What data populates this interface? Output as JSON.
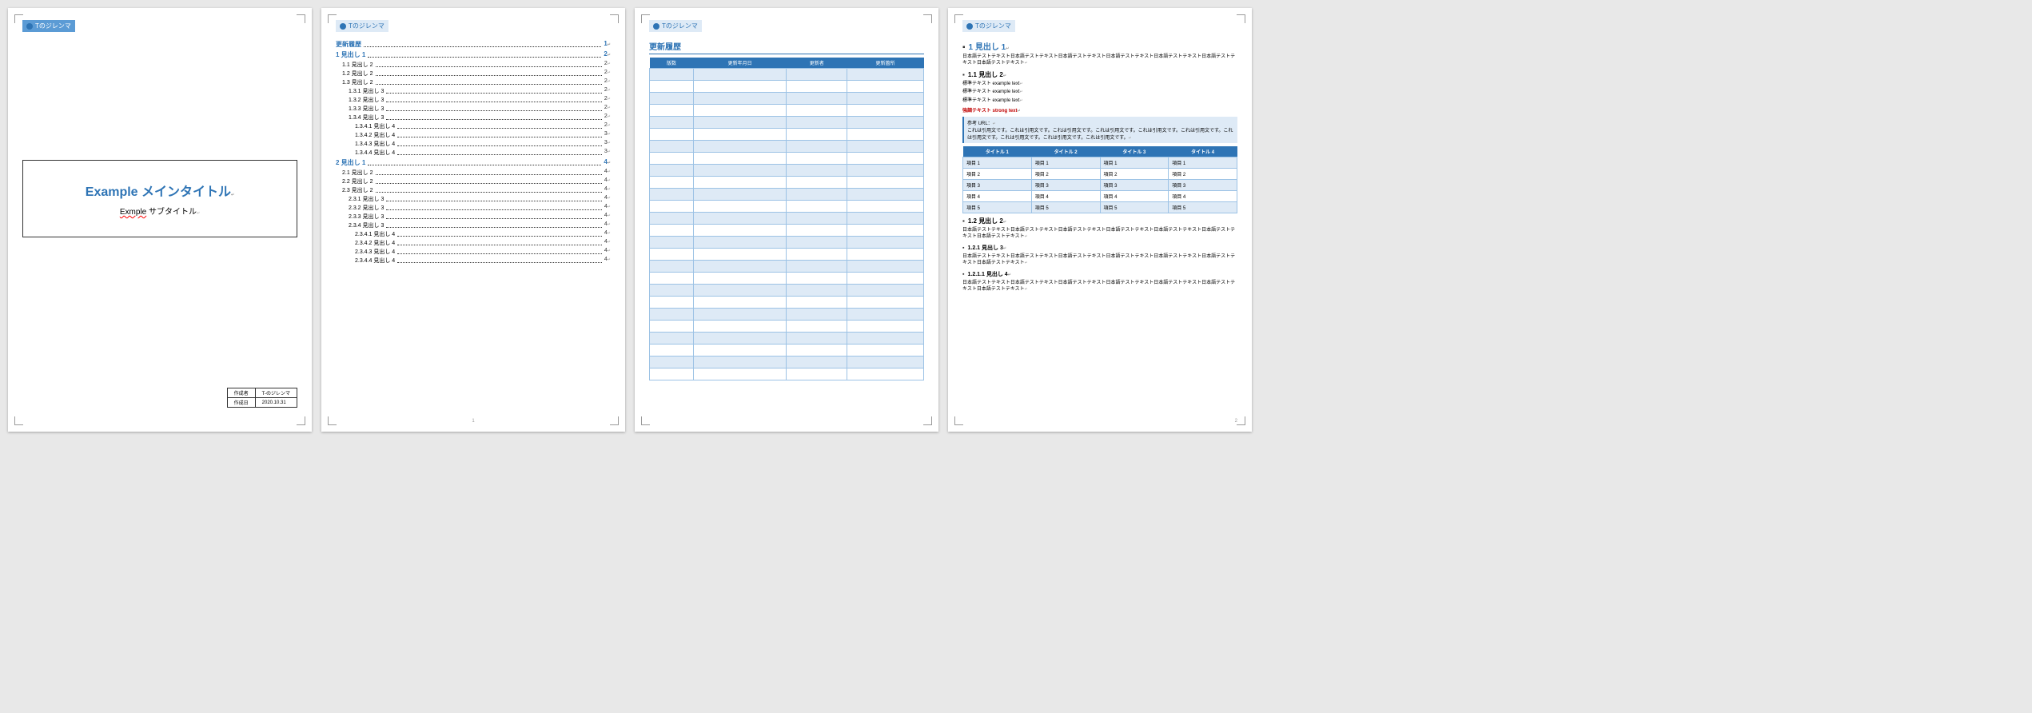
{
  "header": {
    "brand": "Tのジレンマ"
  },
  "page1": {
    "main_title": "Example メインタイトル",
    "sub_title_prefix": "Exmple",
    "sub_title_rest": " サブタイトル",
    "meta": {
      "author_label": "作成者",
      "author": "T-のジレンマ",
      "date_label": "作成日",
      "date": "2020.10.31"
    }
  },
  "toc": {
    "items": [
      {
        "lvl": 1,
        "label": "更新履歴",
        "page": "1"
      },
      {
        "lvl": 1,
        "label": "1 見出し 1",
        "page": "2"
      },
      {
        "lvl": 2,
        "label": "1.1 見出し 2",
        "page": "2"
      },
      {
        "lvl": 2,
        "label": "1.2 見出し 2",
        "page": "2"
      },
      {
        "lvl": 2,
        "label": "1.3 見出し 2",
        "page": "2"
      },
      {
        "lvl": 3,
        "label": "1.3.1 見出し 3",
        "page": "2"
      },
      {
        "lvl": 3,
        "label": "1.3.2 見出し 3",
        "page": "2"
      },
      {
        "lvl": 3,
        "label": "1.3.3 見出し 3",
        "page": "2"
      },
      {
        "lvl": 3,
        "label": "1.3.4 見出し 3",
        "page": "2"
      },
      {
        "lvl": 4,
        "label": "1.3.4.1 見出し 4",
        "page": "2"
      },
      {
        "lvl": 4,
        "label": "1.3.4.2 見出し 4",
        "page": "3"
      },
      {
        "lvl": 4,
        "label": "1.3.4.3 見出し 4",
        "page": "3"
      },
      {
        "lvl": 4,
        "label": "1.3.4.4 見出し 4",
        "page": "3"
      },
      {
        "lvl": 1,
        "label": "2 見出し 1",
        "page": "4"
      },
      {
        "lvl": 2,
        "label": "2.1 見出し 2",
        "page": "4"
      },
      {
        "lvl": 2,
        "label": "2.2 見出し 2",
        "page": "4"
      },
      {
        "lvl": 2,
        "label": "2.3 見出し 2",
        "page": "4"
      },
      {
        "lvl": 3,
        "label": "2.3.1 見出し 3",
        "page": "4"
      },
      {
        "lvl": 3,
        "label": "2.3.2 見出し 3",
        "page": "4"
      },
      {
        "lvl": 3,
        "label": "2.3.3 見出し 3",
        "page": "4"
      },
      {
        "lvl": 3,
        "label": "2.3.4 見出し 3",
        "page": "4"
      },
      {
        "lvl": 4,
        "label": "2.3.4.1 見出し 4",
        "page": "4"
      },
      {
        "lvl": 4,
        "label": "2.3.4.2 見出し 4",
        "page": "4"
      },
      {
        "lvl": 4,
        "label": "2.3.4.3 見出し 4",
        "page": "4"
      },
      {
        "lvl": 4,
        "label": "2.3.4.4 見出し 4",
        "page": "4"
      }
    ]
  },
  "history": {
    "title": "更新履歴",
    "cols": [
      "版数",
      "更新年月日",
      "更新者",
      "更新箇所"
    ],
    "rows": 26
  },
  "page4": {
    "h1": "1 見出し 1",
    "body1": "日本語テストテキスト日本語テストテキスト日本語テストテキスト日本語テストテキスト日本語テストテキスト日本語テストテキスト日本語テストテキスト",
    "h2a": "1.1 見出し 2",
    "std_lines": [
      "標準テキスト example text",
      "標準テキスト example text",
      "標準テキスト example text"
    ],
    "strong": "強調テキスト strong text",
    "quote_label": "参考 URL：",
    "quote_body": "これは引用文です。これは引用文です。これは引用文です。これは引用文です。これは引用文です。これは引用文です。これは引用文です。これは引用文です。これは引用文です。これは引用文です。",
    "table_headers": [
      "タイトル 1",
      "タイトル 2",
      "タイトル 3",
      "タイトル 4"
    ],
    "table_rows": [
      [
        "項目 1",
        "項目 1",
        "項目 1",
        "項目 1"
      ],
      [
        "項目 2",
        "項目 2",
        "項目 2",
        "項目 2"
      ],
      [
        "項目 3",
        "項目 3",
        "項目 3",
        "項目 3"
      ],
      [
        "項目 4",
        "項目 4",
        "項目 4",
        "項目 4"
      ],
      [
        "項目 5",
        "項目 5",
        "項目 5",
        "項目 5"
      ]
    ],
    "h2b": "1.2 見出し 2",
    "body2": "日本語テストテキスト日本語テストテキスト日本語テストテキスト日本語テストテキスト日本語テストテキスト日本語テストテキスト日本語テストテキスト",
    "h3": "1.2.1 見出し 3",
    "body3": "日本語テストテキスト日本語テストテキスト日本語テストテキスト日本語テストテキスト日本語テストテキスト日本語テストテキスト日本語テストテキスト",
    "h4": "1.2.1.1 見出し 4",
    "body4": "日本語テストテキスト日本語テストテキスト日本語テストテキスト日本語テストテキスト日本語テストテキスト日本語テストテキスト日本語テストテキスト"
  },
  "page_footer": {
    "p2": "1",
    "p4": "2"
  }
}
